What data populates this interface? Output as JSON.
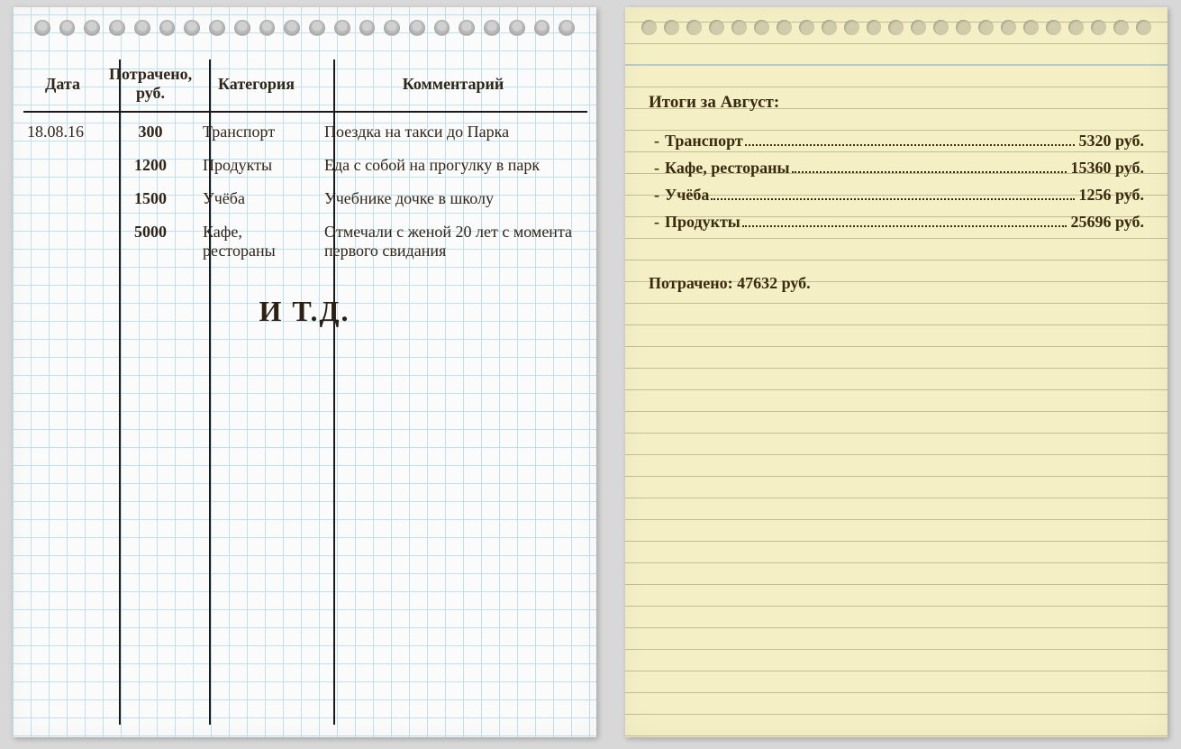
{
  "ledger": {
    "headers": {
      "date": "Дата",
      "amount": "Потрачено, руб.",
      "category": "Категория",
      "comment": "Комментарий"
    },
    "rows": [
      {
        "date": "18.08.16",
        "amount": "300",
        "category": "Транспорт",
        "comment": "Поездка на такси до Парка"
      },
      {
        "date": "",
        "amount": "1200",
        "category": "Продукты",
        "comment": "Еда с собой на прогулку в парк"
      },
      {
        "date": "",
        "amount": "1500",
        "category": "Учёба",
        "comment": "Учебнике дочке в школу"
      },
      {
        "date": "",
        "amount": "5000",
        "category": "Кафе, рестораны",
        "comment": "Отмечали с женой 20 лет с момента первого свидания"
      }
    ],
    "etc": "И Т.Д."
  },
  "summary": {
    "title": "Итоги за Август:",
    "currency": "руб.",
    "items": [
      {
        "name": "Транспорт",
        "value": "5320"
      },
      {
        "name": "Кафе, рестораны",
        "value": "15360"
      },
      {
        "name": "Учёба",
        "value": "1256"
      },
      {
        "name": "Продукты",
        "value": "25696"
      }
    ],
    "total_label": "Потрачено:",
    "total_value": "47632"
  }
}
